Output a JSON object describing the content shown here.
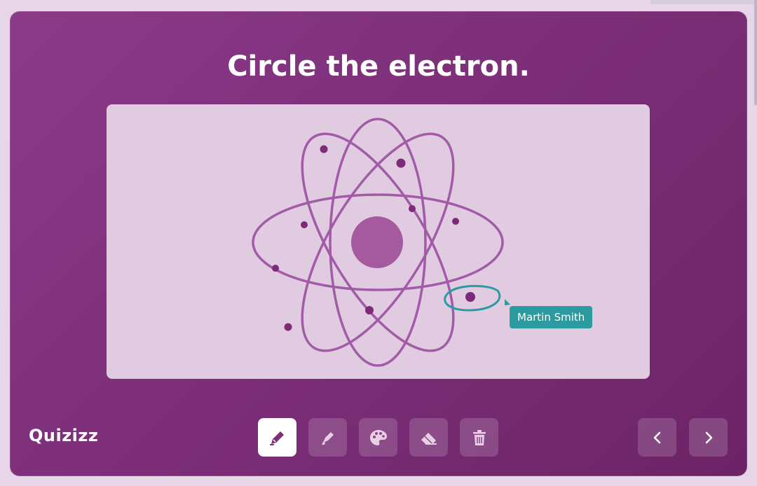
{
  "question": {
    "title": "Circle the electron."
  },
  "annotation": {
    "author_label": "Martin Smith"
  },
  "brand": {
    "logo_text": "Quizizz"
  },
  "toolbar": {
    "tools": [
      {
        "icon": "pencil-icon",
        "active": true
      },
      {
        "icon": "highlighter-icon",
        "active": false
      },
      {
        "icon": "palette-icon",
        "active": false
      },
      {
        "icon": "eraser-icon",
        "active": false
      },
      {
        "icon": "trash-icon",
        "active": false
      }
    ],
    "navigation": [
      {
        "icon": "chevron-left-icon"
      },
      {
        "icon": "chevron-right-icon"
      }
    ]
  },
  "colors": {
    "card_gradient_start": "#8b3a88",
    "card_gradient_end": "#6c2466",
    "canvas_bg": "#e0cbe0",
    "orbit": "#a25ba7",
    "nucleus": "#a55aa0",
    "electron": "#7d2a78",
    "annotation_teal": "#2b9b9f"
  }
}
